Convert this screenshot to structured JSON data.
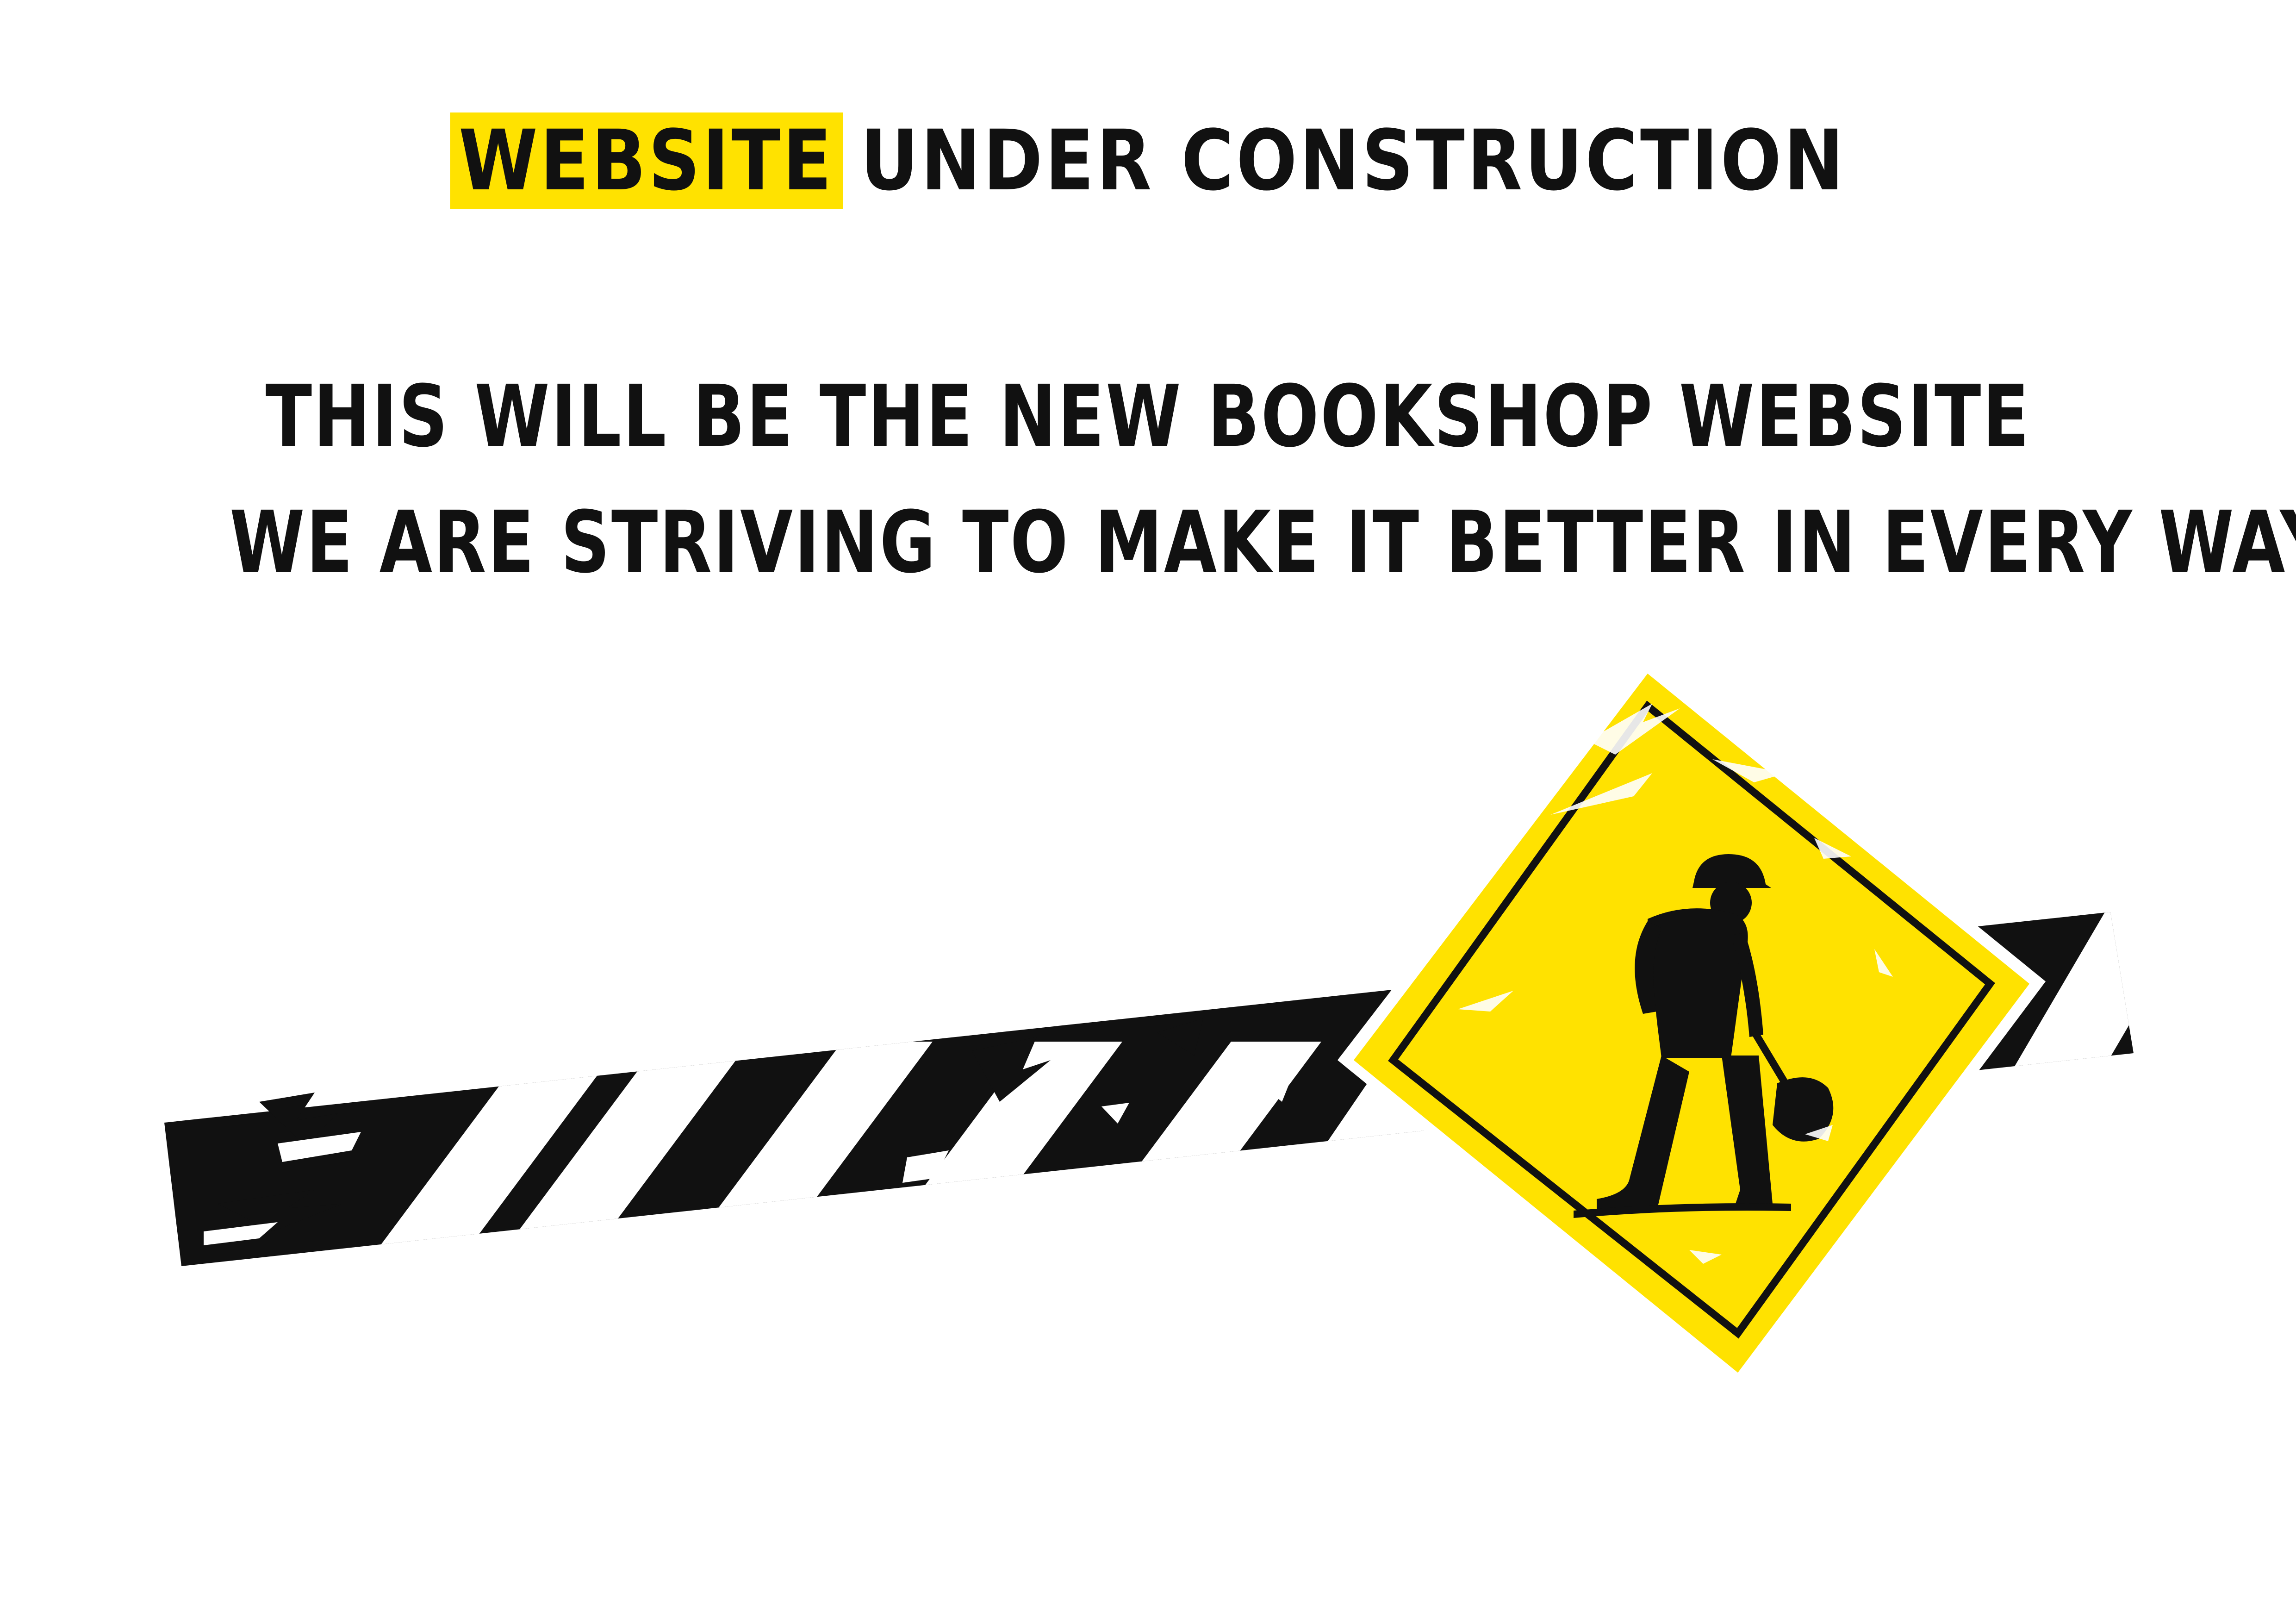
{
  "header": {
    "highlight_text": "WEBSITE",
    "rest_text": "UNDER CONSTRUCTION"
  },
  "message": {
    "line1": "THIS WILL BE THE NEW BOOKSHOP WEBSITE",
    "line2": "WE ARE STRIVING TO MAKE IT BETTER IN EVERY WAY"
  },
  "colors": {
    "accent_yellow": "#ffe200",
    "ink": "#111111",
    "background": "#ffffff"
  },
  "icons": {
    "tape": "caution-tape",
    "sign": "men-at-work-sign-icon"
  }
}
